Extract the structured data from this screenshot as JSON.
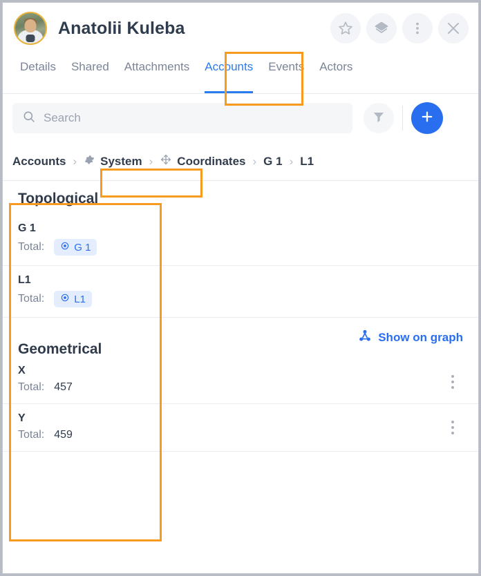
{
  "header": {
    "title": "Anatolii Kuleba",
    "avatar_name": "user-avatar",
    "actions": [
      {
        "name": "favorite-star-icon",
        "label": "Favorite"
      },
      {
        "name": "layers-icon",
        "label": "Layers"
      },
      {
        "name": "more-vertical-icon",
        "label": "More"
      },
      {
        "name": "close-icon",
        "label": "Close"
      }
    ]
  },
  "tabs": [
    {
      "label": "Details",
      "active": false
    },
    {
      "label": "Shared",
      "active": false
    },
    {
      "label": "Attachments",
      "active": false
    },
    {
      "label": "Accounts",
      "active": true
    },
    {
      "label": "Events",
      "active": false
    },
    {
      "label": "Actors",
      "active": false
    }
  ],
  "toolbar": {
    "search_value": "",
    "search_placeholder": "Search",
    "search_icon": "search-icon",
    "filter_icon": "filter-funnel-icon",
    "add_icon": "plus-icon"
  },
  "breadcrumb": [
    {
      "label": "Accounts",
      "icon": null
    },
    {
      "label": "System",
      "icon": "gear-icon"
    },
    {
      "label": "Coordinates",
      "icon": "move-arrows-icon"
    },
    {
      "label": "G 1",
      "icon": null
    },
    {
      "label": "L1",
      "icon": null
    }
  ],
  "breadcrumb_separator": "›",
  "sections": [
    {
      "title": "Topological",
      "rows": [
        {
          "name": "G 1",
          "total_label": "Total:",
          "chip": "G 1",
          "chip_icon": "target-dot-icon",
          "value": null,
          "kebab": false
        },
        {
          "name": "L1",
          "total_label": "Total:",
          "chip": "L1",
          "chip_icon": "target-dot-icon",
          "value": null,
          "kebab": false
        }
      ],
      "action": null
    },
    {
      "title": "Geometrical",
      "rows": [
        {
          "name": "X",
          "total_label": "Total:",
          "chip": null,
          "chip_icon": null,
          "value": "457",
          "kebab": true
        },
        {
          "name": "Y",
          "total_label": "Total:",
          "chip": null,
          "chip_icon": null,
          "value": "459",
          "kebab": true
        }
      ],
      "action": {
        "label": "Show on graph",
        "icon": "graph-node-icon"
      }
    }
  ],
  "colors": {
    "accent_blue": "#2a6ef0",
    "tab_active_blue": "#2a7bf0",
    "annotation_orange": "#f79a1e",
    "chip_bg": "#e3edfd",
    "avatar_ring": "#e8b339",
    "muted_text": "#7b8496"
  },
  "annotations": [
    {
      "name": "annotation-accounts-tab",
      "target": "Accounts tab"
    },
    {
      "name": "annotation-system-crumb",
      "target": "System breadcrumb"
    },
    {
      "name": "annotation-left-column",
      "target": "Topological / Geometrical labels column"
    }
  ]
}
